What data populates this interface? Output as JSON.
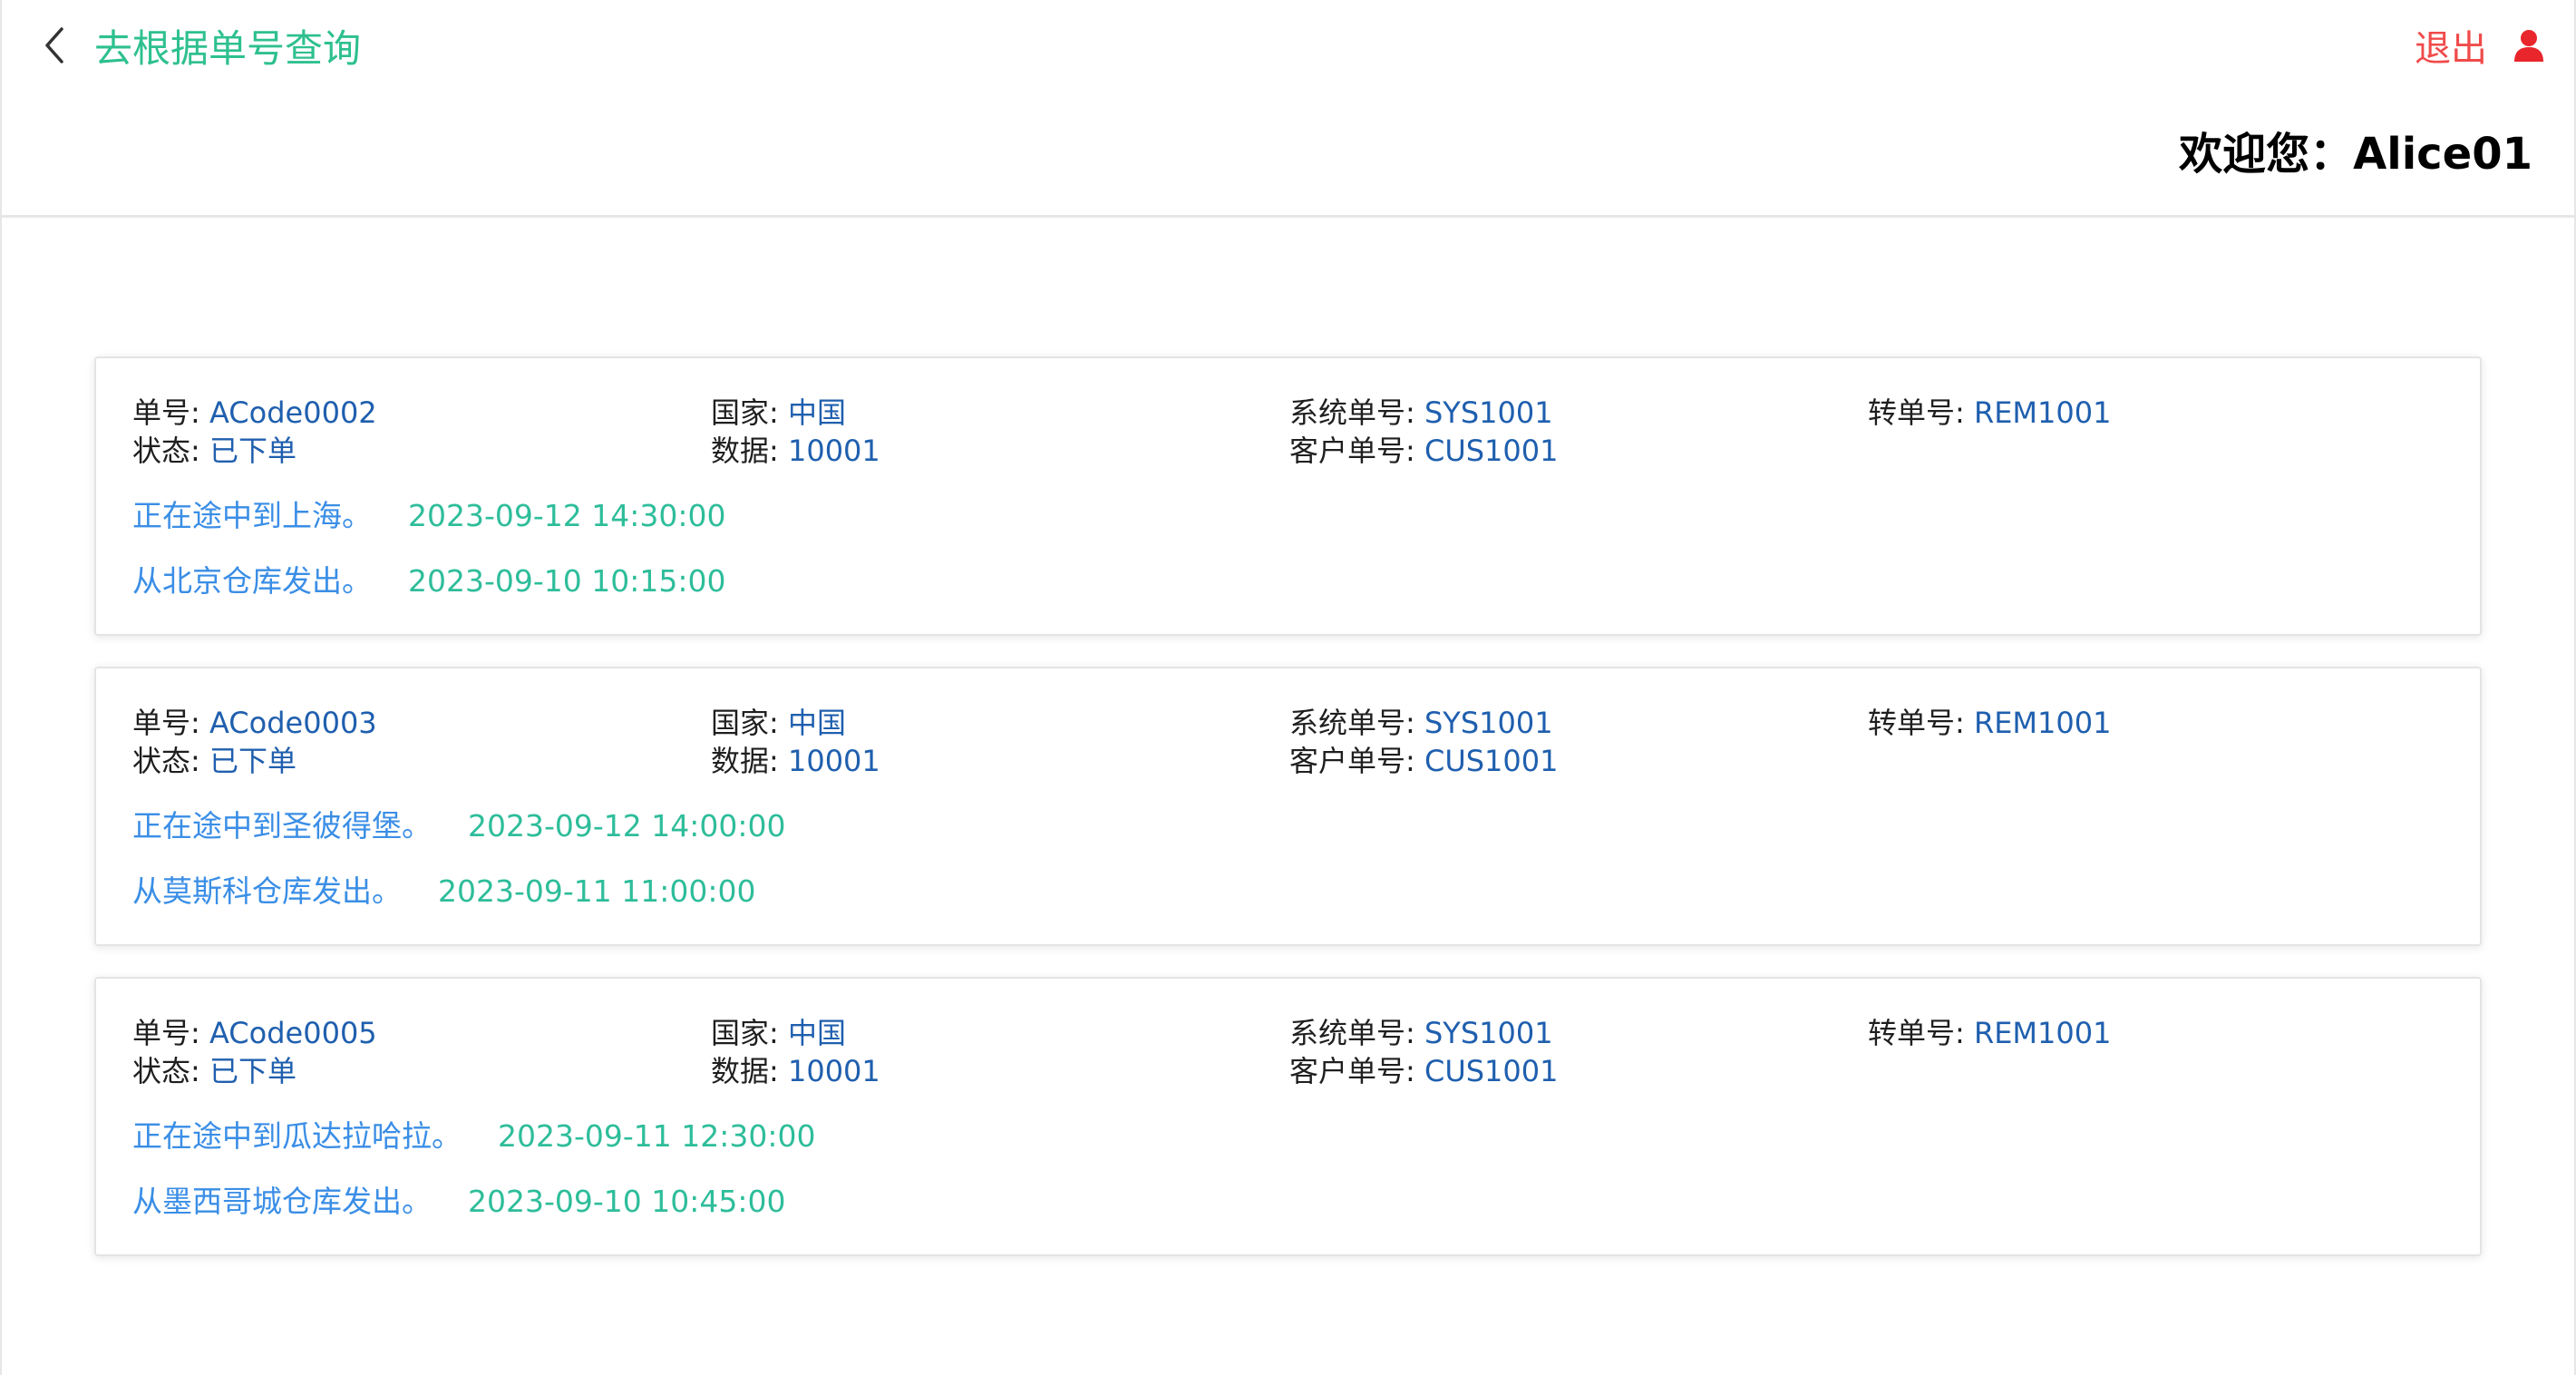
{
  "header": {
    "back_label": "去根据单号查询",
    "logout_label": "退出",
    "welcome": "欢迎您：Alice01"
  },
  "labels": {
    "order_no": "单号: ",
    "status": "状态: ",
    "country": "国家: ",
    "data": "数据: ",
    "system_no": "系统单号: ",
    "customer_no": "客户单号: ",
    "transfer_no": "转单号: "
  },
  "orders": [
    {
      "order_no": "ACode0002",
      "status": "已下单",
      "country": "中国",
      "data": "10001",
      "system_no": "SYS1001",
      "customer_no": "CUS1001",
      "transfer_no": "REM1001",
      "events": [
        {
          "text": "正在途中到上海。",
          "time": "2023-09-12 14:30:00"
        },
        {
          "text": "从北京仓库发出。",
          "time": "2023-09-10 10:15:00"
        }
      ]
    },
    {
      "order_no": "ACode0003",
      "status": "已下单",
      "country": "中国",
      "data": "10001",
      "system_no": "SYS1001",
      "customer_no": "CUS1001",
      "transfer_no": "REM1001",
      "events": [
        {
          "text": "正在途中到圣彼得堡。",
          "time": "2023-09-12 14:00:00"
        },
        {
          "text": "从莫斯科仓库发出。",
          "time": "2023-09-11 11:00:00"
        }
      ]
    },
    {
      "order_no": "ACode0005",
      "status": "已下单",
      "country": "中国",
      "data": "10001",
      "system_no": "SYS1001",
      "customer_no": "CUS1001",
      "transfer_no": "REM1001",
      "events": [
        {
          "text": "正在途中到瓜达拉哈拉。",
          "time": "2023-09-11 12:30:00"
        },
        {
          "text": "从墨西哥城仓库发出。",
          "time": "2023-09-10 10:45:00"
        }
      ]
    }
  ],
  "icons": {
    "back": "chevron-left-icon",
    "user": "user-icon"
  },
  "colors": {
    "accent_green": "#2ec08f",
    "logout_red": "#f04b4b",
    "value_blue": "#1f5fae",
    "event_blue": "#3a8ee6",
    "time_green": "#2ebd9a"
  }
}
